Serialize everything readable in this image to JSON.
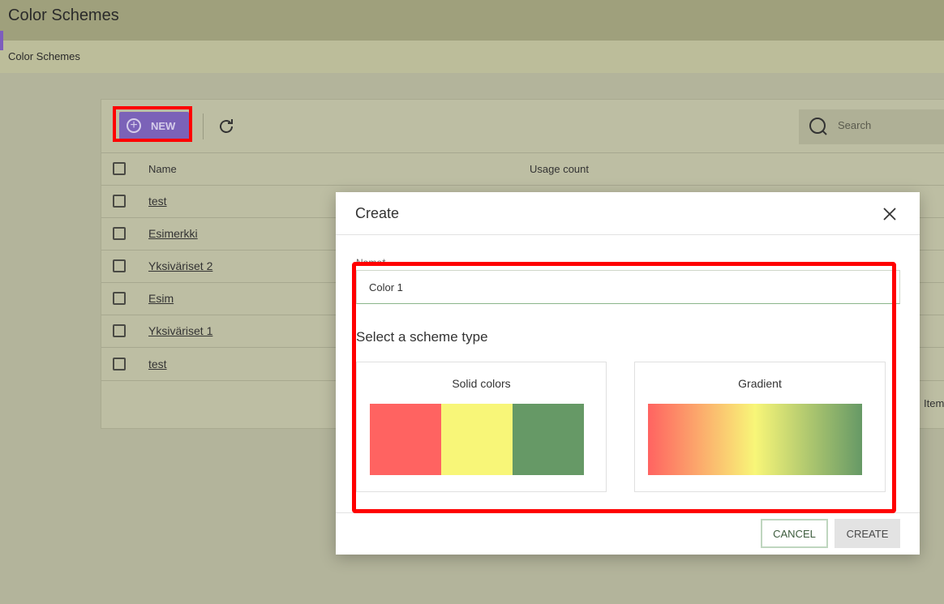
{
  "header": {
    "title": "Color Schemes"
  },
  "breadcrumb": {
    "current": "Color Schemes"
  },
  "toolbar": {
    "new_label": "NEW",
    "search_placeholder": "Search"
  },
  "table": {
    "columns": [
      "Name",
      "Usage count"
    ],
    "rows": [
      {
        "name": "test"
      },
      {
        "name": "Esimerkki"
      },
      {
        "name": "Yksiväriset 2"
      },
      {
        "name": "Esim"
      },
      {
        "name": "Yksiväriset 1"
      },
      {
        "name": "test"
      }
    ],
    "footer_partial": "Item"
  },
  "dialog": {
    "title": "Create",
    "name_label": "Name*",
    "name_value": "Color 1",
    "scheme_heading": "Select a scheme type",
    "options": [
      {
        "label": "Solid colors",
        "colors": [
          "#ff6361",
          "#f8f678",
          "#669966"
        ]
      },
      {
        "label": "Gradient",
        "colors": [
          "#ff6361",
          "#f8f678",
          "#669966"
        ]
      }
    ],
    "cancel_label": "CANCEL",
    "create_label": "CREATE"
  },
  "colors": {
    "accent": "#7b62b8",
    "highlight": "#ff0000"
  }
}
